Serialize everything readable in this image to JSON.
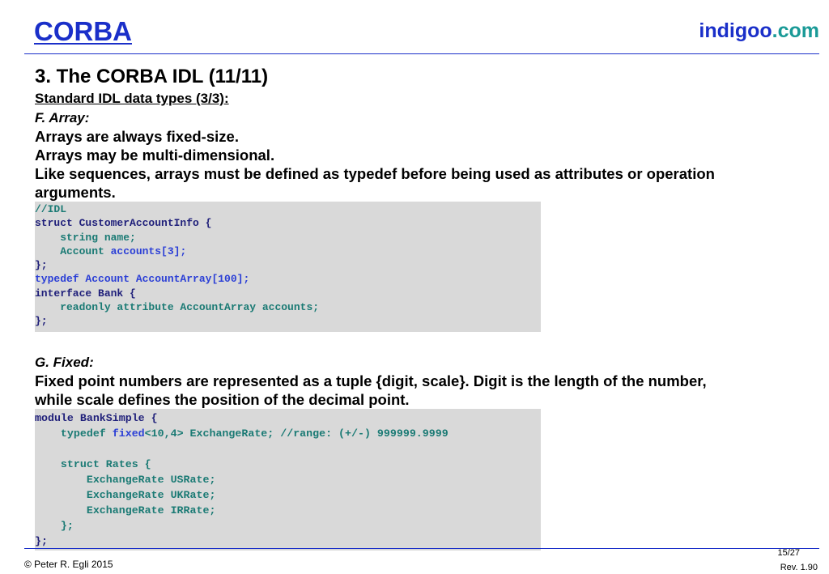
{
  "header": {
    "title": "CORBA",
    "brand_main": "indigoo",
    "brand_suffix": ".com"
  },
  "slide": {
    "section_title": "3. The CORBA IDL (11/11)",
    "subtitle": "Standard IDL data types (3/3):",
    "array_heading": "F. Array:",
    "array_lines": [
      "Arrays are always fixed-size.",
      "Arrays may be multi-dimensional.",
      "Like sequences, arrays must be defined as typedef before being used as attributes or operation",
      "arguments."
    ],
    "code1": {
      "l1": "//IDL",
      "l2": "struct CustomerAccountInfo {",
      "l3": "    string name;",
      "l4a": "    Account ",
      "l4b": "accounts[3];",
      "l5": "};",
      "l6a": "typedef Account ",
      "l6b": "AccountArray[100];",
      "l7": "interface Bank {",
      "l8": "    readonly attribute AccountArray accounts;",
      "l9": "};"
    },
    "fixed_heading": "G. Fixed:",
    "fixed_lines": [
      "Fixed point numbers are represented as a tuple {digit, scale}. Digit is the length of the number,",
      "while scale defines the position of the decimal point."
    ],
    "code2": {
      "l1": "module BankSimple {",
      "l2a": "    typedef ",
      "l2b": "fixed",
      "l2c": "<10,4> ExchangeRate; //range: (+/-) 999999.9999",
      "l3": "",
      "l4": "    struct Rates {",
      "l5": "        ExchangeRate USRate;",
      "l6": "        ExchangeRate UKRate;",
      "l7": "        ExchangeRate IRRate;",
      "l8": "    };",
      "l9": "};"
    }
  },
  "footer": {
    "copyright": "© Peter R. Egli 2015",
    "page": "15/27",
    "revision": "Rev. 1.90"
  }
}
